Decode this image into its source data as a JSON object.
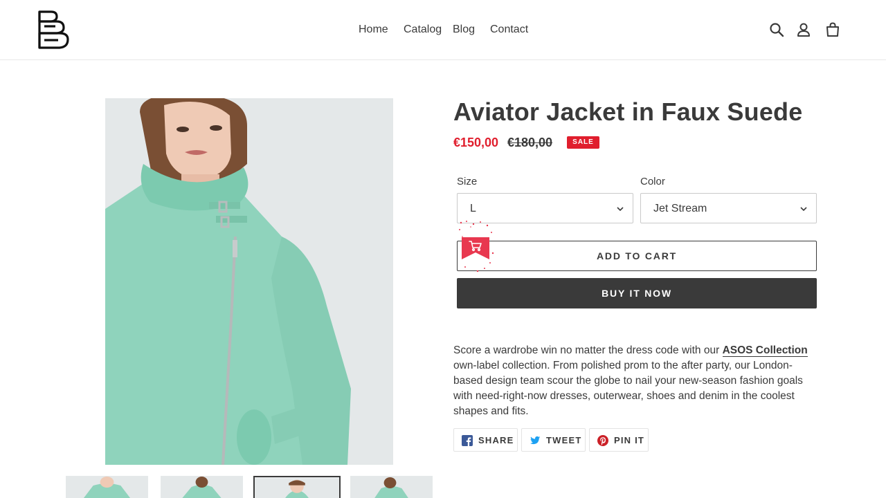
{
  "header": {
    "logo_name": "brand-logo",
    "nav": [
      {
        "label": "Home"
      },
      {
        "label": "Catalog"
      },
      {
        "label": "Blog"
      },
      {
        "label": "Contact"
      }
    ],
    "icons": [
      "search-icon",
      "account-icon",
      "cart-icon"
    ]
  },
  "product": {
    "title": "Aviator Jacket in Faux Suede",
    "price_sale": "€150,00",
    "price_original": "€180,00",
    "sale_badge": "SALE",
    "options": {
      "size_label": "Size",
      "size_value": "L",
      "color_label": "Color",
      "color_value": "Jet Stream"
    },
    "add_to_cart": "ADD TO CART",
    "buy_now": "BUY IT NOW",
    "description": {
      "before_link": "Score a wardrobe win no matter the dress code with our ",
      "link_text": "ASOS Collection",
      "after_link": " own-label collection. From polished prom to the after party, our London-based design team scour the globe to nail your new-season fashion goals with need-right-now dresses, outerwear, shoes and denim in the coolest shapes and fits."
    },
    "share": [
      {
        "label": "SHARE",
        "icon": "facebook-icon"
      },
      {
        "label": "TWEET",
        "icon": "twitter-icon"
      },
      {
        "label": "PIN IT",
        "icon": "pinterest-icon"
      }
    ]
  },
  "colors": {
    "text": "#3a3a3a",
    "sale": "#e01e2d",
    "jacket": "#8fd3bc",
    "facebook": "#3b5998",
    "twitter": "#1da1f2",
    "pinterest": "#cb2027"
  }
}
